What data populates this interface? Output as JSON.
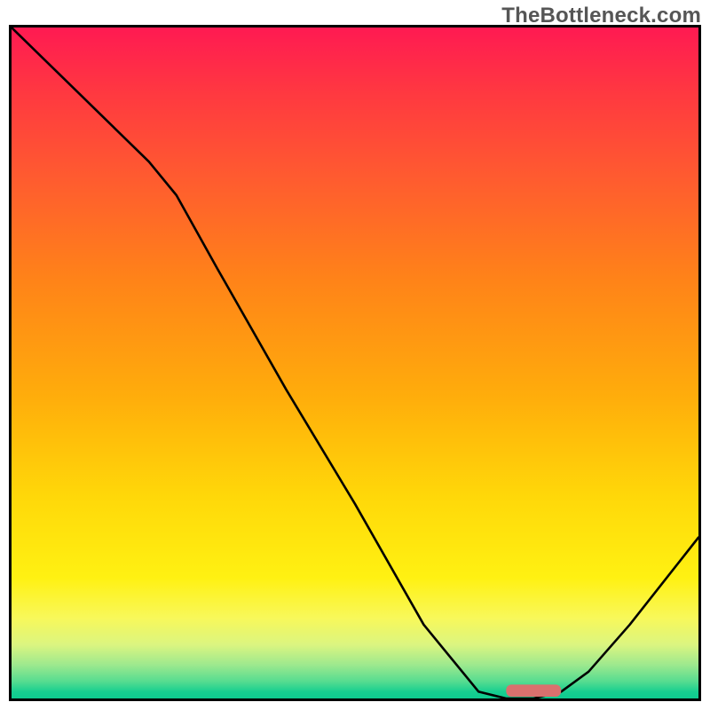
{
  "watermark": "TheBottleneck.com",
  "colors": {
    "gradient_top": "#ff1a52",
    "gradient_bottom": "#0ecb8f",
    "curve": "#000000",
    "marker": "#d9706e",
    "border": "#000000",
    "watermark_text": "#565656"
  },
  "chart_data": {
    "type": "line",
    "title": "",
    "xlabel": "",
    "ylabel": "",
    "xlim": [
      0,
      100
    ],
    "ylim": [
      0,
      100
    ],
    "grid": false,
    "legend": false,
    "series": [
      {
        "name": "bottleneck-curve",
        "x": [
          0,
          5,
          10,
          15,
          20,
          24,
          30,
          40,
          50,
          60,
          68,
          72,
          76,
          80,
          84,
          90,
          100
        ],
        "y": [
          100,
          95,
          90,
          85,
          80,
          75,
          64,
          46,
          29,
          11,
          1,
          0,
          0,
          1,
          4,
          11,
          24
        ]
      }
    ],
    "marker": {
      "name": "optimal-range",
      "x_start": 72,
      "x_end": 80,
      "y": 0,
      "thickness_pct": 1.5
    },
    "background": {
      "type": "vertical-gradient",
      "description": "red (bad) at top through orange, yellow, to green (good) at bottom"
    }
  }
}
